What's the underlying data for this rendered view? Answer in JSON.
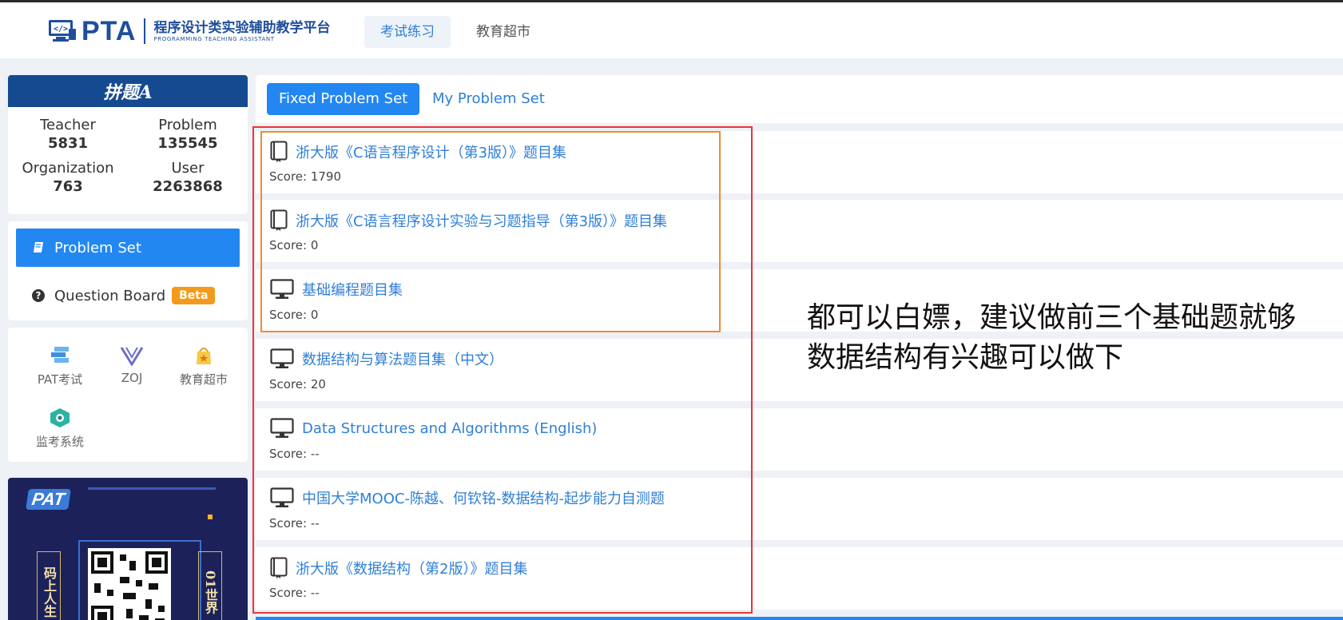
{
  "header": {
    "logo_main": "PTA",
    "logo_cn": "程序设计类实验辅助教学平台",
    "logo_en": "PROGRAMMING TEACHING ASSISTANT",
    "nav": [
      {
        "label": "考试练习",
        "active": true
      },
      {
        "label": "教育超市",
        "active": false
      }
    ]
  },
  "sidebar": {
    "brand": "拼题A",
    "stats": [
      {
        "label": "Teacher",
        "value": "5831"
      },
      {
        "label": "Problem",
        "value": "135545"
      },
      {
        "label": "Organization",
        "value": "763"
      },
      {
        "label": "User",
        "value": "2263868"
      }
    ],
    "menu": {
      "problem_set": "Problem Set",
      "question_board": "Question Board",
      "beta": "Beta"
    },
    "tools": [
      {
        "label": "PAT考试",
        "icon": "pat-icon"
      },
      {
        "label": "ZOJ",
        "icon": "zoj-icon"
      },
      {
        "label": "教育超市",
        "icon": "market-icon"
      },
      {
        "label": "监考系统",
        "icon": "proctor-icon"
      }
    ],
    "promo": {
      "pat": "PAT",
      "left_text": "码上人生",
      "right_text": "01世界"
    }
  },
  "main": {
    "tabs": [
      {
        "label": "Fixed Problem Set",
        "active": true
      },
      {
        "label": "My Problem Set",
        "active": false
      }
    ],
    "problem_sets": [
      {
        "title": "浙大版《C语言程序设计（第3版）》题目集",
        "score": "Score: 1790",
        "icon": "book-icon"
      },
      {
        "title": "浙大版《C语言程序设计实验与习题指导（第3版）》题目集",
        "score": "Score: 0",
        "icon": "book-icon"
      },
      {
        "title": "基础编程题目集",
        "score": "Score: 0",
        "icon": "monitor-icon"
      },
      {
        "title": "数据结构与算法题目集（中文）",
        "score": "Score: 20",
        "icon": "monitor-icon"
      },
      {
        "title": "Data Structures and Algorithms (English)",
        "score": "Score: --",
        "icon": "monitor-icon"
      },
      {
        "title": "中国大学MOOC-陈越、何钦铭-数据结构-起步能力自测题",
        "score": "Score: --",
        "icon": "monitor-icon"
      },
      {
        "title": "浙大版《数据结构（第2版）》题目集",
        "score": "Score: --",
        "icon": "book-icon"
      }
    ]
  },
  "annotation": {
    "line1": "都可以白嫖，建议做前三个基础题就够",
    "line2": "数据结构有兴趣可以做下"
  },
  "colors": {
    "primary": "#2387f2",
    "link": "#2f7fd6",
    "brand_dark": "#154a91",
    "red_highlight": "#e8343b",
    "orange_highlight": "#f08c2e",
    "beta_badge": "#f39a1c"
  }
}
